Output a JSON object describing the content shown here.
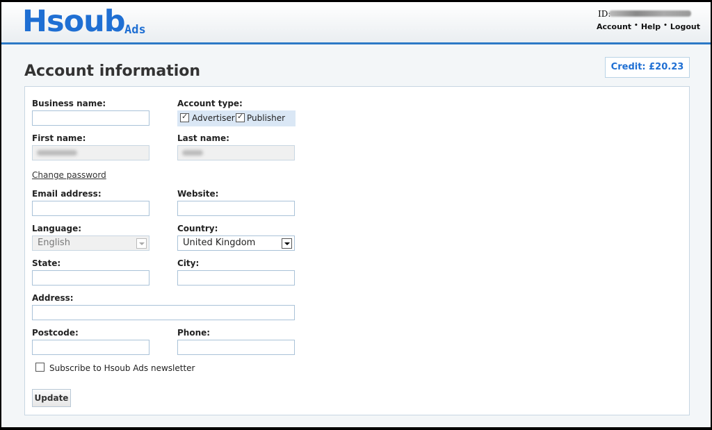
{
  "header": {
    "logo": "Hsoub",
    "logo_sub": "Ads",
    "id_label": "ID:",
    "links": [
      "Account",
      "Help",
      "Logout"
    ],
    "separator": "•"
  },
  "credit": "Credit: £20.23",
  "page_title": "Account information",
  "form": {
    "business_name": {
      "label": "Business name:",
      "value": ""
    },
    "account_type": {
      "label": "Account type:",
      "advertiser": {
        "label": "Advertiser",
        "checked": true
      },
      "publisher": {
        "label": "Publisher",
        "checked": true
      }
    },
    "first_name": {
      "label": "First name:"
    },
    "last_name": {
      "label": "Last name:"
    },
    "change_password": "Change password",
    "email": {
      "label": "Email address:",
      "value": ""
    },
    "website": {
      "label": "Website:",
      "value": ""
    },
    "language": {
      "label": "Language:",
      "value": "English"
    },
    "country": {
      "label": "Country:",
      "value": "United Kingdom"
    },
    "state": {
      "label": "State:",
      "value": ""
    },
    "city": {
      "label": "City:",
      "value": ""
    },
    "address": {
      "label": "Address:",
      "value": ""
    },
    "postcode": {
      "label": "Postcode:",
      "value": ""
    },
    "phone": {
      "label": "Phone:",
      "value": ""
    },
    "newsletter": {
      "label": "Subscribe to Hsoub Ads newsletter",
      "checked": false
    },
    "update_label": "Update"
  },
  "colors": {
    "accent": "#1f6fd3",
    "header_rule": "#2c79c6",
    "account_type_bg": "#dae7f5"
  }
}
